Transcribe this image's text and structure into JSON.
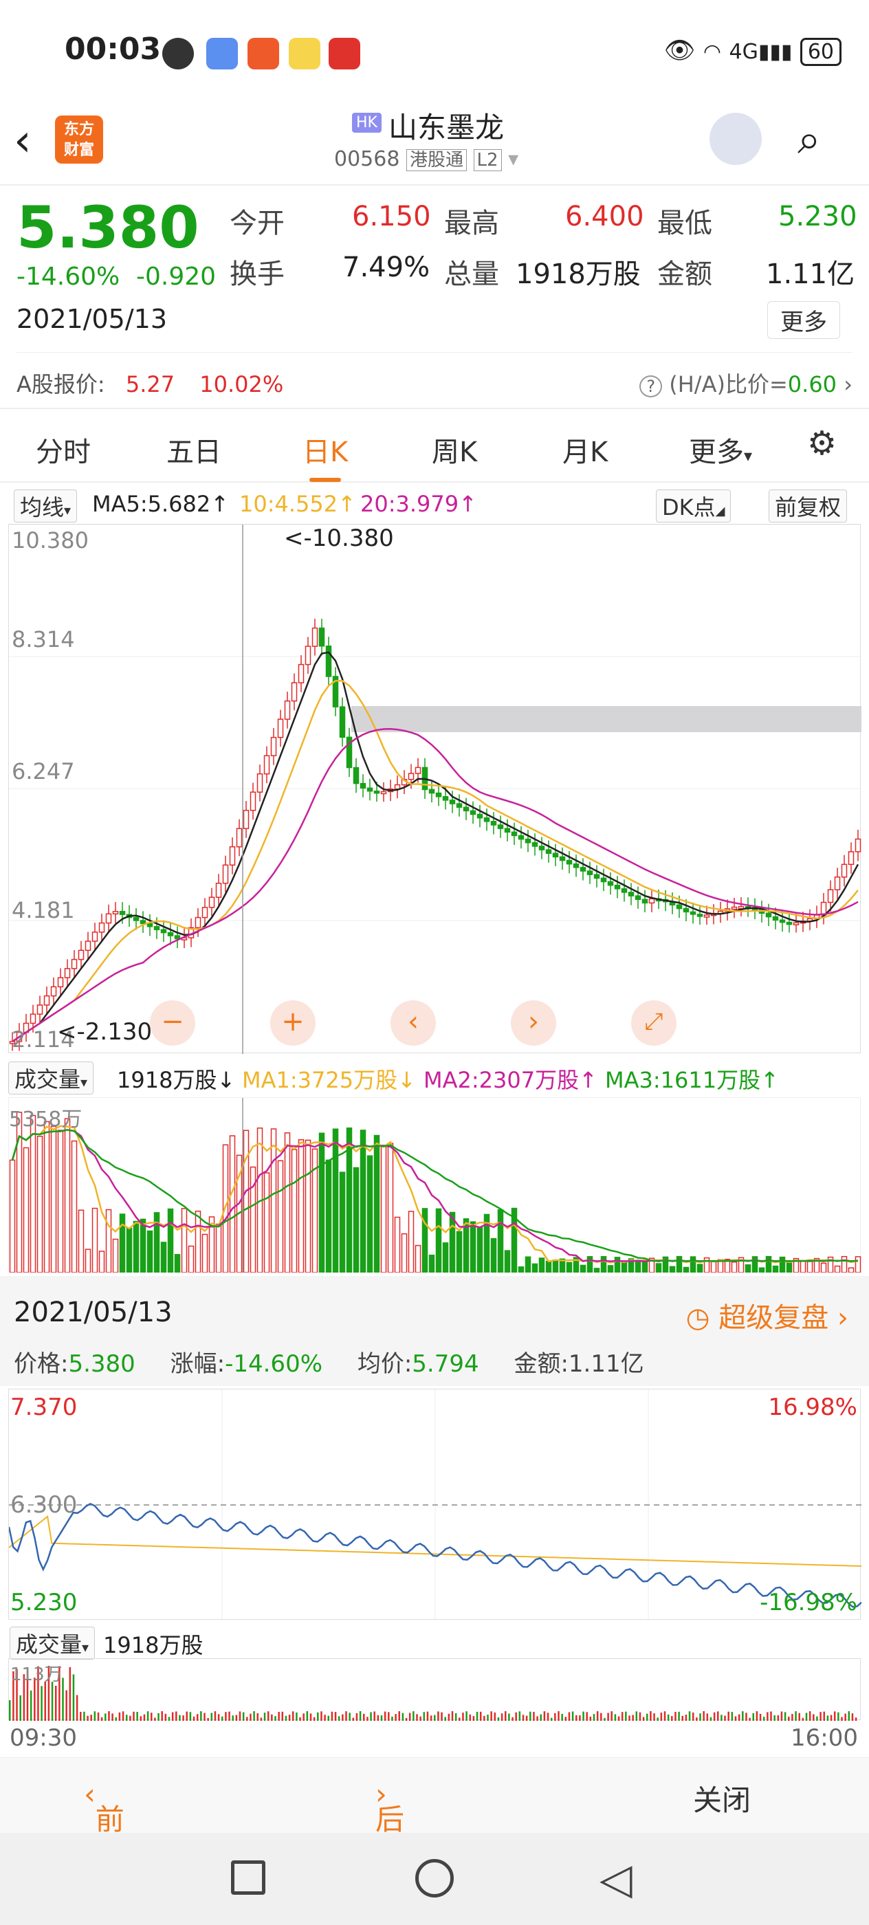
{
  "status_bar": {
    "time": "00:03",
    "network": "4G",
    "battery": "60"
  },
  "header": {
    "back_icon": "chevron-left",
    "app_logo_text_line1": "东方",
    "app_logo_text_line2": "财富",
    "market_badge": "HK",
    "stock_name": "山东墨龙",
    "stock_code": "00568",
    "connect_tag": "港股通",
    "level_tag": "L2"
  },
  "quote": {
    "price": "5.380",
    "change_pct": "-14.60%",
    "change_amt": "-0.920",
    "date": "2021/05/13",
    "open_label": "今开",
    "open": "6.150",
    "high_label": "最高",
    "high": "6.400",
    "low_label": "最低",
    "low": "5.230",
    "turnover_label": "换手",
    "turnover": "7.49%",
    "volume_label": "总量",
    "volume": "1918万股",
    "amount_label": "金额",
    "amount": "1.11亿",
    "more_button": "更多",
    "a_share_label": "A股报价:",
    "a_share_price": "5.27",
    "a_share_pct": "10.02%",
    "ha_ratio": "(H/A)比价=",
    "ha_ratio_value": "0.60"
  },
  "tabs": [
    {
      "label": "分时"
    },
    {
      "label": "五日"
    },
    {
      "label": "日K"
    },
    {
      "label": "周K"
    },
    {
      "label": "月K"
    },
    {
      "label": "更多"
    }
  ],
  "ma_line": {
    "selector": "均线",
    "ma5": "MA5:5.682↑",
    "ma10": "10:4.552↑",
    "ma20": "20:3.979↑",
    "dk": "DK点",
    "adjust": "前复权"
  },
  "kchart": {
    "y_labels": [
      "10.380",
      "8.314",
      "6.247",
      "4.181",
      "2.114"
    ],
    "max_label": "<-10.380",
    "min_label": "<-2.130"
  },
  "vol_line": {
    "selector": "成交量",
    "vol": "1918万股↓",
    "ma1": "MA1:3725万股↓",
    "ma2": "MA2:2307万股↑",
    "ma3": "MA3:1611万股↑",
    "max_label": "5358万"
  },
  "detail": {
    "date": "2021/05/13",
    "replay": "超级复盘",
    "price_label": "价格:",
    "price": "5.380",
    "pct_label": "涨幅:",
    "pct": "-14.60%",
    "avg_label": "均价:",
    "avg": "5.794",
    "amount_label": "金额:",
    "amount": "1.11亿"
  },
  "intraday": {
    "top_price": "7.370",
    "mid_price": "6.300",
    "bottom_price": "5.230",
    "top_pct": "16.98%",
    "bottom_pct": "-16.98%",
    "vol_selector": "成交量",
    "vol": "1918万股",
    "vol_max": "113万",
    "time_start": "09:30",
    "time_end": "16:00"
  },
  "bottom": {
    "prev": "前一天",
    "next": "后一天",
    "close": "关闭"
  },
  "colors": {
    "up": "#e02b2b",
    "down": "#19a019",
    "accent": "#f07a1c",
    "ma5": "#222222",
    "ma10": "#f0b429",
    "ma20": "#c8219a"
  }
}
